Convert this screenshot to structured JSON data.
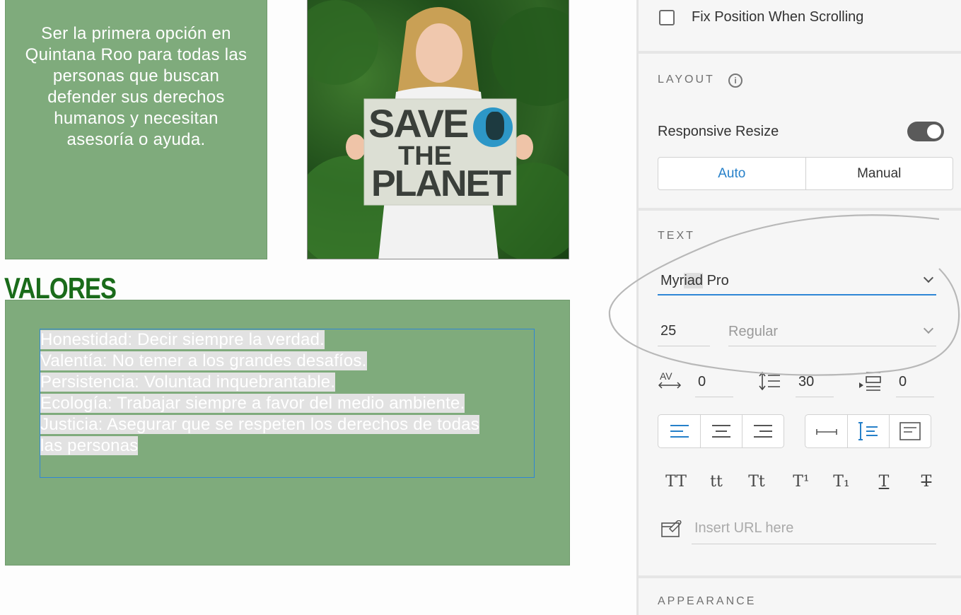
{
  "canvas": {
    "mission_text": "Ser la primera opción en Quintana Roo para todas las personas que buscan defender sus derechos humanos y necesitan asesoría o ayuda.",
    "photo_sign": {
      "line1": "SAVE",
      "line2": "THE",
      "line3": "PLANET"
    },
    "values_heading": "VALORES",
    "values": [
      "Honestidad: Decir siempre la verdad.",
      "Valentía: No temer a los grandes desafíos.",
      "Persistencia: Voluntad inquebrantable.",
      "Ecología: Trabajar siempre a favor del medio ambiente.",
      "Justicia: Asegurar que se respeten los derechos de todas",
      "las personas"
    ]
  },
  "panel": {
    "fix_position_label": "Fix Position When Scrolling",
    "fix_position_checked": false,
    "layout": {
      "title": "LAYOUT",
      "responsive_resize_label": "Responsive Resize",
      "responsive_resize_on": true,
      "modes": [
        "Auto",
        "Manual"
      ],
      "active_mode": "Auto"
    },
    "text": {
      "title": "TEXT",
      "font_family_prefix": "Myr",
      "font_family_highlight": "iad",
      "font_family_suffix": " Pro",
      "font_size": "25",
      "font_weight_placeholder": "Regular",
      "character_spacing": "0",
      "line_spacing": "30",
      "paragraph_spacing": "0",
      "align_options": [
        "align-left",
        "align-center",
        "align-right"
      ],
      "active_align": "align-left",
      "box_options": [
        "point-text",
        "area-text",
        "fixed-text"
      ],
      "active_box": "area-text",
      "styles": [
        "TT",
        "tt",
        "Tt",
        "T¹",
        "T₁",
        "T",
        "T"
      ],
      "url_placeholder": "Insert URL here"
    },
    "appearance": {
      "title": "APPEARANCE"
    }
  },
  "colors": {
    "box_green": "#7fab7c",
    "heading_green": "#1a6b1a",
    "accent_blue": "#2680c9",
    "selection_gray": "#e2e2e2"
  }
}
